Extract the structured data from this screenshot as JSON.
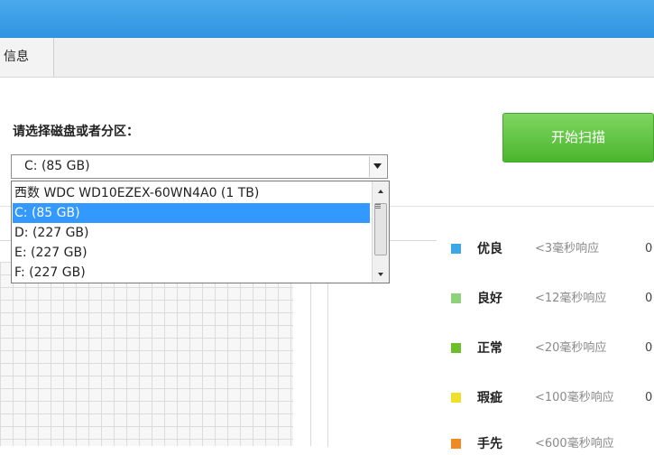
{
  "tabs": [
    {
      "label": "信息"
    }
  ],
  "prompt": "请选择磁盘或者分区：",
  "scan_button": "开始扫描",
  "select": {
    "value": "C:  (85 GB)"
  },
  "dropdown_options": [
    {
      "label": "西数 WDC WD10EZEX-60WN4A0  (1 TB)",
      "selected": false
    },
    {
      "label": "C:  (85 GB)",
      "selected": true
    },
    {
      "label": "D:  (227 GB)",
      "selected": false
    },
    {
      "label": "E:  (227 GB)",
      "selected": false
    },
    {
      "label": "F:  (227 GB)",
      "selected": false
    }
  ],
  "legend": [
    {
      "name": "优良",
      "desc": "<3毫秒响应",
      "count": "0",
      "color": "#3ba6e8"
    },
    {
      "name": "良好",
      "desc": "<12毫秒响应",
      "count": "0",
      "color": "#8fd07a"
    },
    {
      "name": "正常",
      "desc": "<20毫秒响应",
      "count": "0",
      "color": "#6cbf2a"
    },
    {
      "name": "瑕疵",
      "desc": "<100毫秒响应",
      "count": "0",
      "color": "#f0e02a"
    },
    {
      "name": "手先",
      "desc": "<600毫秒响应",
      "count": "",
      "color": "#f08a22"
    }
  ],
  "colors": {
    "accent_blue": "#3399ff",
    "scan_green": "#5bbf3a",
    "titlebar": "#3a9ee6"
  }
}
